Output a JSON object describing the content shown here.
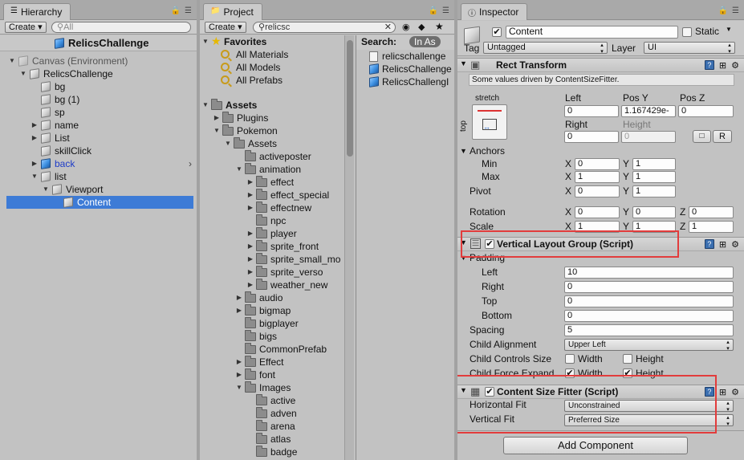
{
  "hierarchy": {
    "tab_label": "Hierarchy",
    "create_label": "Create",
    "search_placeholder": "All",
    "scene_name": "RelicsChallenge",
    "rows": [
      {
        "label": "Canvas (Environment)",
        "depth": 0,
        "arrow": "down",
        "style": "dim",
        "icon": "cube-grey-icon"
      },
      {
        "label": "RelicsChallenge",
        "depth": 1,
        "arrow": "down",
        "style": "normal",
        "icon": "cube-icon"
      },
      {
        "label": "bg",
        "depth": 2,
        "arrow": "",
        "style": "normal",
        "icon": "cube-icon"
      },
      {
        "label": "bg (1)",
        "depth": 2,
        "arrow": "",
        "style": "normal",
        "icon": "cube-icon"
      },
      {
        "label": "sp",
        "depth": 2,
        "arrow": "",
        "style": "normal",
        "icon": "cube-icon"
      },
      {
        "label": "name",
        "depth": 2,
        "arrow": "right",
        "style": "normal",
        "icon": "cube-icon"
      },
      {
        "label": "List",
        "depth": 2,
        "arrow": "right",
        "style": "normal",
        "icon": "cube-icon"
      },
      {
        "label": "skillClick",
        "depth": 2,
        "arrow": "",
        "style": "normal",
        "icon": "cube-icon"
      },
      {
        "label": "back",
        "depth": 2,
        "arrow": "right",
        "style": "blue",
        "icon": "prefab-cube-icon"
      },
      {
        "label": "list",
        "depth": 2,
        "arrow": "down",
        "style": "normal",
        "icon": "cube-icon"
      },
      {
        "label": "Viewport",
        "depth": 3,
        "arrow": "down",
        "style": "normal",
        "icon": "cube-icon"
      },
      {
        "label": "Content",
        "depth": 4,
        "arrow": "",
        "style": "selected",
        "icon": "cube-icon"
      }
    ]
  },
  "project": {
    "tab_label": "Project",
    "create_label": "Create",
    "search_value": "relicsc",
    "search_header": "Search:",
    "search_scope": "In As",
    "favorites_label": "Favorites",
    "favorites": [
      "All Materials",
      "All Models",
      "All Prefabs"
    ],
    "assets_label": "Assets",
    "tree": [
      {
        "label": "Plugins",
        "depth": 1,
        "arrow": "right"
      },
      {
        "label": "Pokemon",
        "depth": 1,
        "arrow": "down"
      },
      {
        "label": "Assets",
        "depth": 2,
        "arrow": "down"
      },
      {
        "label": "activeposter",
        "depth": 3,
        "arrow": ""
      },
      {
        "label": "animation",
        "depth": 3,
        "arrow": "down"
      },
      {
        "label": "effect",
        "depth": 4,
        "arrow": "right"
      },
      {
        "label": "effect_special",
        "depth": 4,
        "arrow": "right"
      },
      {
        "label": "effectnew",
        "depth": 4,
        "arrow": "right"
      },
      {
        "label": "npc",
        "depth": 4,
        "arrow": ""
      },
      {
        "label": "player",
        "depth": 4,
        "arrow": "right"
      },
      {
        "label": "sprite_front",
        "depth": 4,
        "arrow": "right"
      },
      {
        "label": "sprite_small_mo",
        "depth": 4,
        "arrow": "right"
      },
      {
        "label": "sprite_verso",
        "depth": 4,
        "arrow": "right"
      },
      {
        "label": "weather_new",
        "depth": 4,
        "arrow": "right"
      },
      {
        "label": "audio",
        "depth": 3,
        "arrow": "right"
      },
      {
        "label": "bigmap",
        "depth": 3,
        "arrow": "right"
      },
      {
        "label": "bigplayer",
        "depth": 3,
        "arrow": ""
      },
      {
        "label": "bigs",
        "depth": 3,
        "arrow": ""
      },
      {
        "label": "CommonPrefab",
        "depth": 3,
        "arrow": ""
      },
      {
        "label": "Effect",
        "depth": 3,
        "arrow": "right"
      },
      {
        "label": "font",
        "depth": 3,
        "arrow": "right"
      },
      {
        "label": "Images",
        "depth": 3,
        "arrow": "down"
      },
      {
        "label": "active",
        "depth": 4,
        "arrow": ""
      },
      {
        "label": "adven",
        "depth": 4,
        "arrow": ""
      },
      {
        "label": "arena",
        "depth": 4,
        "arrow": ""
      },
      {
        "label": "atlas",
        "depth": 4,
        "arrow": ""
      },
      {
        "label": "badge",
        "depth": 4,
        "arrow": ""
      }
    ],
    "results": [
      {
        "label": "relicschallenge",
        "icon": "script-file-icon"
      },
      {
        "label": "RelicsChallenge",
        "icon": "prefab-cube-icon"
      },
      {
        "label": "RelicsChallengI",
        "icon": "prefab-cube-icon"
      }
    ]
  },
  "inspector": {
    "tab_label": "Inspector",
    "object_name": "Content",
    "static_label": "Static",
    "tag_label": "Tag",
    "tag_value": "Untagged",
    "layer_label": "Layer",
    "layer_value": "UI",
    "rect_transform": {
      "title": "Rect Transform",
      "note": "Some values driven by ContentSizeFitter.",
      "anchor_h": "stretch",
      "anchor_v": "top",
      "col_left": "Left",
      "col_posy": "Pos Y",
      "col_posz": "Pos Z",
      "left_value": "0",
      "posy_value": "1.167429e-",
      "posz_value": "0",
      "col_right": "Right",
      "col_height": "Height",
      "right_value": "0",
      "height_value": "0",
      "raw_label": "R",
      "anchors_label": "Anchors",
      "min_label": "Min",
      "max_label": "Max",
      "min_x": "0",
      "min_y": "1",
      "max_x": "1",
      "max_y": "1",
      "pivot_label": "Pivot",
      "pivot_x": "0",
      "pivot_y": "1",
      "rotation_label": "Rotation",
      "rot_x": "0",
      "rot_y": "0",
      "rot_z": "0",
      "scale_label": "Scale",
      "scale_x": "1",
      "scale_y": "1",
      "scale_z": "1",
      "x_label": "X",
      "y_label": "Y",
      "z_label": "Z"
    },
    "vlg": {
      "title": "Vertical Layout Group (Script)",
      "padding_label": "Padding",
      "left_label": "Left",
      "left_value": "10",
      "right_label": "Right",
      "right_value": "0",
      "top_label": "Top",
      "top_value": "0",
      "bottom_label": "Bottom",
      "bottom_value": "0",
      "spacing_label": "Spacing",
      "spacing_value": "5",
      "alignment_label": "Child Alignment",
      "alignment_value": "Upper Left",
      "controls_label": "Child Controls Size",
      "expand_label": "Child Force Expand",
      "width_label": "Width",
      "height_label": "Height",
      "controls_width": false,
      "controls_height": false,
      "expand_width": true,
      "expand_height": true
    },
    "csf": {
      "title": "Content Size Fitter (Script)",
      "hfit_label": "Horizontal Fit",
      "hfit_value": "Unconstrained",
      "vfit_label": "Vertical Fit",
      "vfit_value": "Preferred Size"
    },
    "add_component_label": "Add Component"
  },
  "colors": {
    "selection": "#3d7bd6",
    "highlight_box": "#e23c3c",
    "panel_bg": "#c2c2c2"
  }
}
